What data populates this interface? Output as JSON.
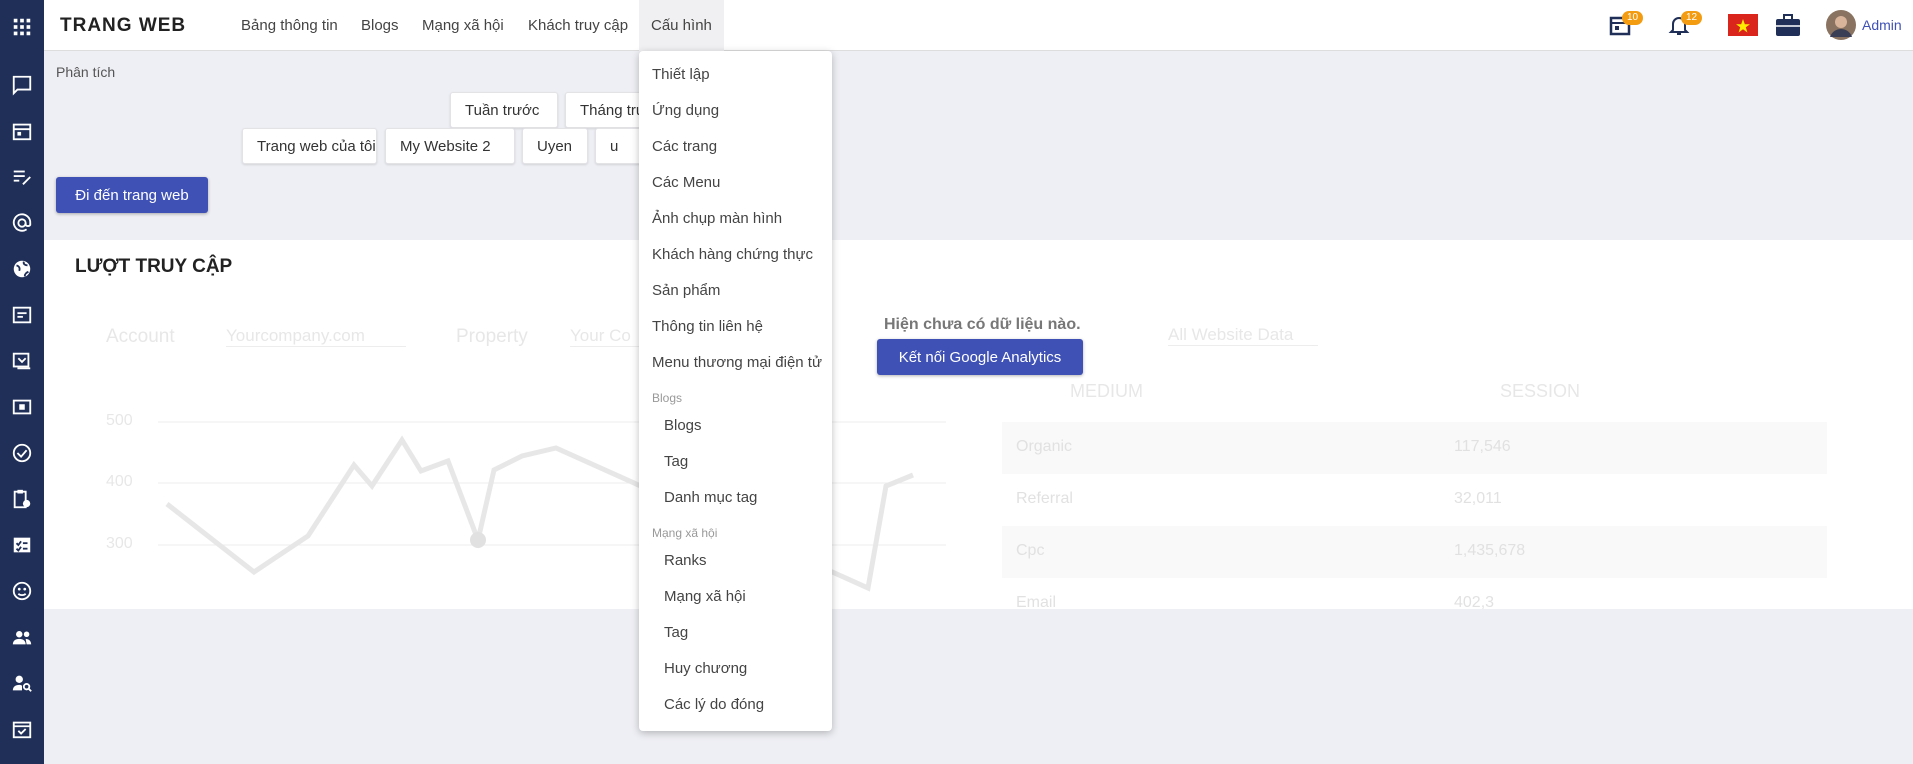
{
  "topbar": {
    "brand": "TRANG WEB",
    "nav": [
      "Bảng thông tin",
      "Blogs",
      "Mạng xã hội",
      "Khách truy cập",
      "Cấu hình"
    ],
    "calendar_badge": "10",
    "notification_badge": "12",
    "user": "Admin"
  },
  "page": {
    "label": "Phân tích",
    "period_chips": [
      "Tuần trước",
      "Tháng trước"
    ],
    "website_chips": [
      "Trang web của tôi",
      "My Website 2",
      "Uyen",
      "u"
    ],
    "go_website": "Đi đến trang web"
  },
  "card": {
    "title": "LƯỢT TRUY CẬP",
    "no_data": "Hiện chưa có dữ liệu nào.",
    "connect": "Kết nối Google Analytics",
    "ghost_left": {
      "account_label": "Account",
      "account_value": "Yourcompany.com",
      "property_label": "Property",
      "property_value": "Your Co",
      "y_ticks": [
        "500",
        "400",
        "300"
      ]
    },
    "ghost_right": {
      "view_value": "All Website Data",
      "headers": [
        "MEDIUM",
        "SESSION"
      ],
      "rows": [
        [
          "Organic",
          "117,546"
        ],
        [
          "Referral",
          "32,011"
        ],
        [
          "Cpc",
          "1,435,678"
        ],
        [
          "Email",
          "402,3"
        ]
      ]
    }
  },
  "dropdown": {
    "items": [
      "Thiết lập",
      "Ứng dụng",
      "Các trang",
      "Các Menu",
      "Ảnh chụp màn hình",
      "Khách hàng chứng thực",
      "Sản phẩm",
      "Thông tin liên hệ",
      "Menu thương mại điện tử"
    ],
    "blogs_header": "Blogs",
    "blogs_items": [
      "Blogs",
      "Tag",
      "Danh mục tag"
    ],
    "social_header": "Mạng xã hội",
    "social_items": [
      "Ranks",
      "Mạng xã hội",
      "Tag",
      "Huy chương",
      "Các lý do đóng"
    ]
  },
  "colors": {
    "sidebar": "#1f2f58",
    "primary": "#3f51b5",
    "badge": "#f39c12"
  }
}
